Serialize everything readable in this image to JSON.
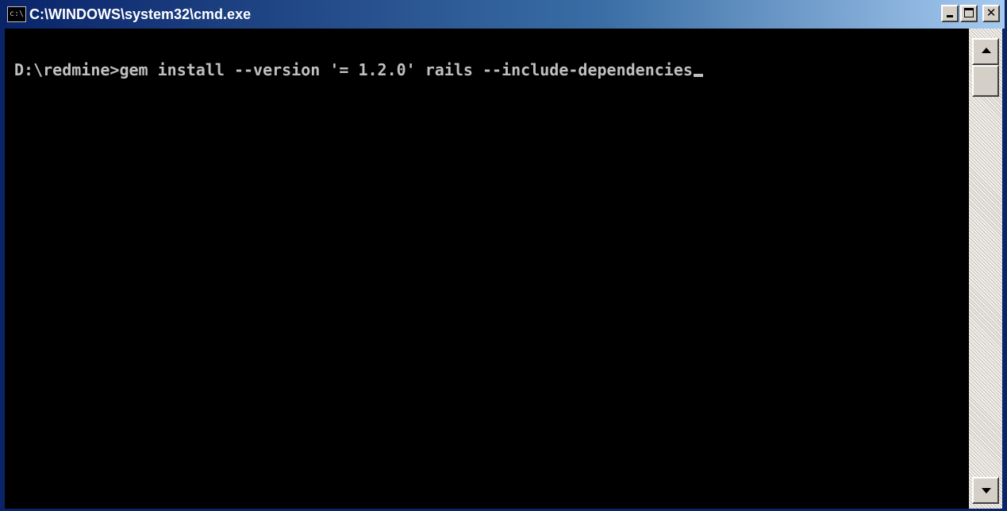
{
  "window": {
    "title": "C:\\WINDOWS\\system32\\cmd.exe",
    "icon_name": "cmd-icon",
    "icon_glyph": "c:\\"
  },
  "console": {
    "prompt": "D:\\redmine>",
    "command": "gem install --version '= 1.2.0' rails --include-dependencies"
  },
  "colors": {
    "titlebar": "#0a246a",
    "console_bg": "#000000",
    "console_text": "#c0c0c0"
  }
}
